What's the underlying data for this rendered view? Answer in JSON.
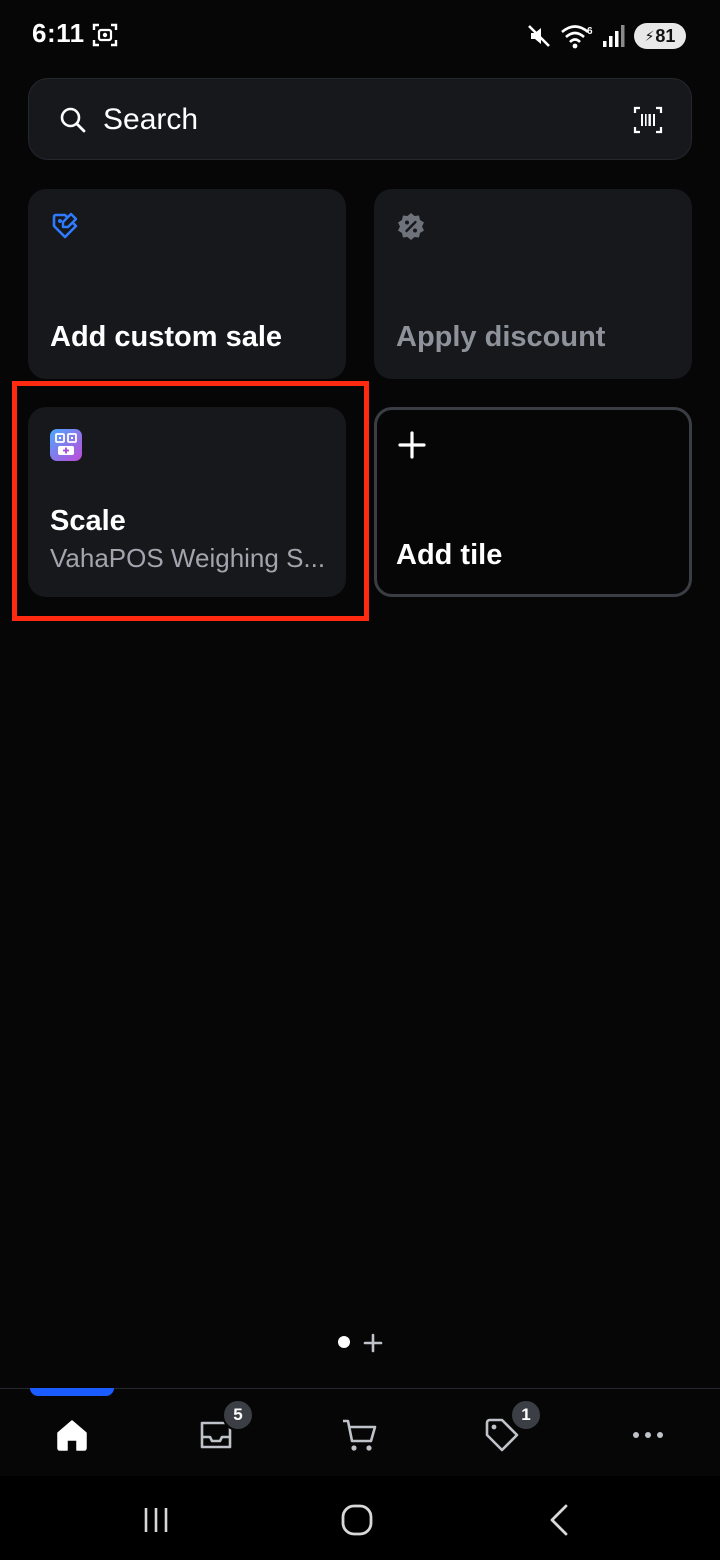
{
  "status_bar": {
    "time": "6:11",
    "battery_level": "81",
    "icons": [
      "screenshot-icon",
      "mute-icon",
      "wifi-6-icon",
      "signal-icon",
      "battery-charging-icon"
    ]
  },
  "search": {
    "label": "Search",
    "icon": "search-icon",
    "scan_icon": "barcode-scan-icon"
  },
  "tiles": [
    {
      "title": "Add custom sale",
      "icon": "tag-edit-icon",
      "enabled": true
    },
    {
      "title": "Apply discount",
      "icon": "discount-badge-icon",
      "enabled": false
    },
    {
      "title": "Scale",
      "subtitle": "VahaPOS Weighing S...",
      "icon": "vahapos-app-icon"
    },
    {
      "title": "Add tile",
      "icon": "plus-icon"
    }
  ],
  "tab_bar": {
    "tabs": [
      {
        "name": "home",
        "icon": "home-icon",
        "active": true
      },
      {
        "name": "orders",
        "icon": "inbox-icon",
        "badge": "5"
      },
      {
        "name": "cart",
        "icon": "cart-icon"
      },
      {
        "name": "discounts",
        "icon": "tag-icon",
        "badge": "1"
      },
      {
        "name": "more",
        "icon": "more-dots-icon"
      }
    ]
  },
  "colors": {
    "background": "#060606",
    "tile_background": "#16181c",
    "accent": "#1a5cff",
    "highlight": "#ff2a0f",
    "muted_text": "#a2a5ad",
    "disabled_text": "#8e929b"
  }
}
